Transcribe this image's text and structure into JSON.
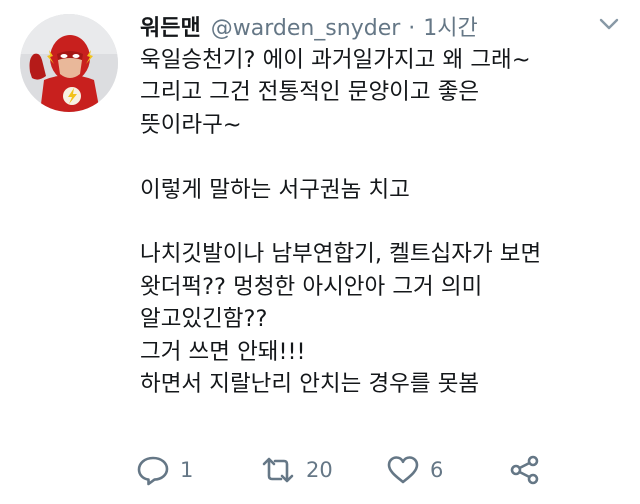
{
  "tweet": {
    "display_name": "워든맨",
    "handle": "@warden_snyder",
    "separator": "·",
    "timestamp": "1시간",
    "lines": [
      "욱일승천기? 에이 과거일가지고 왜 그래~",
      "그리고 그건 전통적인 문양이고 좋은",
      "뜻이라구~",
      "",
      "이렇게 말하는 서구권놈 치고",
      "",
      "나치깃발이나 남부연합기, 켈트십자가 보면",
      "왓더퍽?? 멍청한 아시안아 그거 의미",
      "알고있긴함??",
      "그거 쓰면 안돼!!!",
      "하면서 지랄난리 안치는 경우를 못봄"
    ],
    "actions": {
      "reply_count": "1",
      "retweet_count": "20",
      "like_count": "6"
    }
  },
  "icons": {
    "avatar": "flash-superhero-avatar",
    "caret": "chevron-down-icon",
    "reply": "reply-icon",
    "retweet": "retweet-icon",
    "like": "heart-icon",
    "share": "share-icon"
  },
  "colors": {
    "text": "#14171a",
    "secondary": "#657786",
    "background": "#ffffff",
    "avatar_red": "#c8201e",
    "avatar_yellow": "#f2c21b"
  }
}
